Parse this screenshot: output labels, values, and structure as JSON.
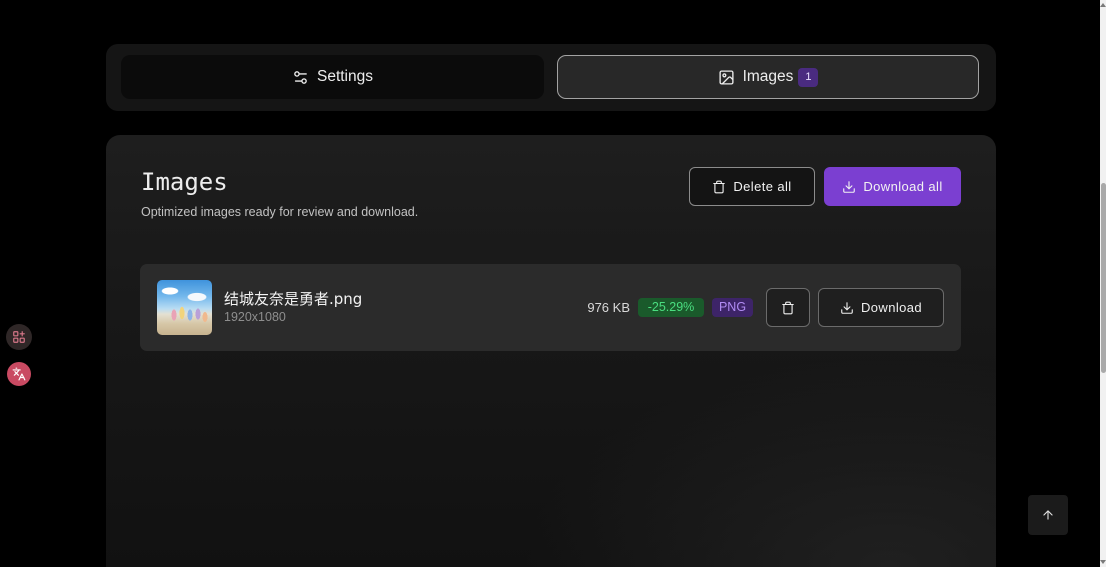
{
  "tabs": [
    {
      "label": "Settings",
      "icon": "sliders-icon",
      "active": false
    },
    {
      "label": "Images",
      "icon": "image-icon",
      "active": true,
      "badge": "1"
    }
  ],
  "panel": {
    "title": "Images",
    "subtitle": "Optimized images ready for review and download.",
    "delete_all": {
      "label": "Delete all",
      "icon": "trash-icon"
    },
    "download_all": {
      "label": "Download all",
      "icon": "download-icon"
    }
  },
  "files": [
    {
      "name": "结城友奈是勇者.png",
      "dimensions": "1920x1080",
      "size": "976 KB",
      "reduction": "-25.29%",
      "format": "PNG",
      "delete_icon": "trash-icon",
      "download": {
        "label": "Download",
        "icon": "download-icon"
      }
    }
  ],
  "floating_tools": [
    {
      "icon": "grid-plus-icon"
    },
    {
      "icon": "translate-icon"
    }
  ],
  "scroll_top": {
    "icon": "arrow-up-icon"
  },
  "colors": {
    "background": "#000000",
    "surface": "#151515",
    "panel": "#1e1e1e",
    "row": "#2b2b2b",
    "accent": "#7b3fd1",
    "badge_count": "#4a2b80",
    "success_bg": "#1a5a2b",
    "success_text": "#4ade80",
    "format_bg": "#3d2468",
    "format_text": "#b18cf4"
  }
}
